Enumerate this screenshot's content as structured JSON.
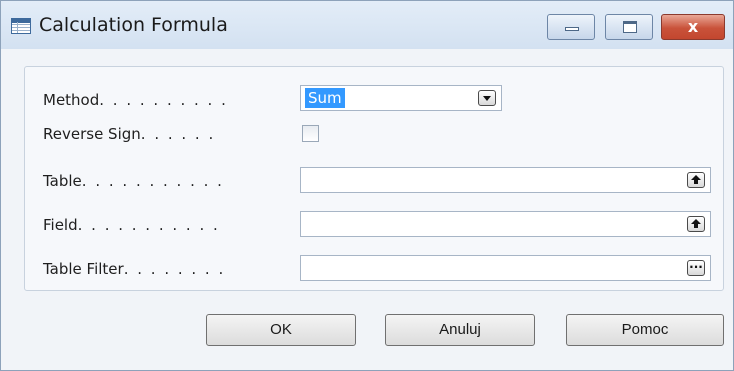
{
  "window": {
    "title": "Calculation Formula",
    "icon": "table-icon",
    "controls": {
      "minimize_icon": "minimize-icon",
      "maximize_icon": "maximize-icon",
      "close_icon": "close-icon",
      "close_glyph": "x"
    }
  },
  "form": {
    "method": {
      "label": "Method",
      "dots": ". . . . . . . . . .",
      "value": "Sum",
      "dropdown_icon": "chevron-down-icon"
    },
    "reverse_sign": {
      "label": "Reverse Sign",
      "dots": ". . . . . .",
      "checked": false
    },
    "table": {
      "label": "Table",
      "dots": ". . . . . . . . . . .",
      "value": "",
      "lookup_icon": "arrow-up-icon"
    },
    "field": {
      "label": "Field",
      "dots": ". . . . . . . . . . .",
      "value": "",
      "lookup_icon": "arrow-up-icon"
    },
    "table_filter": {
      "label": "Table Filter",
      "dots": ". . . . . . . .",
      "value": "",
      "assist_icon": "ellipsis-icon",
      "assist_glyph": "..."
    }
  },
  "buttons": {
    "ok": "OK",
    "cancel": "Anuluj",
    "help": "Pomoc"
  },
  "colors": {
    "selection": "#3399ff",
    "close_button": "#c9523a",
    "titlebar": "#d3e1f1"
  }
}
